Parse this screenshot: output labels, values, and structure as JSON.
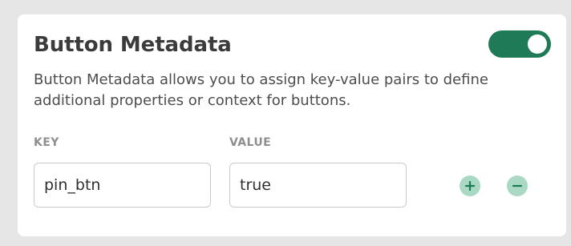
{
  "section": {
    "title": "Button Metadata",
    "description": "Button Metadata allows you to assign key-value pairs to define additional properties or context for buttons.",
    "enabled": true
  },
  "columns": {
    "key_label": "KEY",
    "value_label": "VALUE"
  },
  "rows": [
    {
      "key": "pin_btn",
      "value": "true"
    }
  ],
  "icons": {
    "add": "plus-icon",
    "remove": "minus-icon"
  },
  "colors": {
    "toggle_on": "#1f7a57",
    "action_button": "#a9d8c3",
    "action_icon": "#1f7a57"
  }
}
